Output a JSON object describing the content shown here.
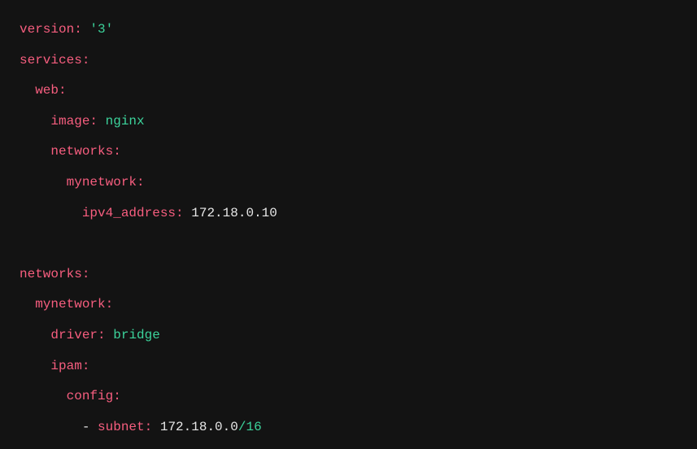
{
  "lines": {
    "l1": {
      "key": "version:",
      "val": "'3'"
    },
    "l2": {
      "key": "services:"
    },
    "l3": {
      "key": "web:"
    },
    "l4": {
      "key": "image:",
      "val": "nginx"
    },
    "l5": {
      "key": "networks:"
    },
    "l6": {
      "key": "mynetwork:"
    },
    "l7": {
      "key": "ipv4_address:",
      "val": "172.18.0.10"
    },
    "l8": {
      "key": "networks:"
    },
    "l9": {
      "key": "mynetwork:"
    },
    "l10": {
      "key": "driver:",
      "val": "bridge"
    },
    "l11": {
      "key": "ipam:"
    },
    "l12": {
      "key": "config:"
    },
    "l13": {
      "dash": "- ",
      "key": "subnet:",
      "val_num": "172.18.0.0",
      "val_suffix": "/16"
    }
  }
}
